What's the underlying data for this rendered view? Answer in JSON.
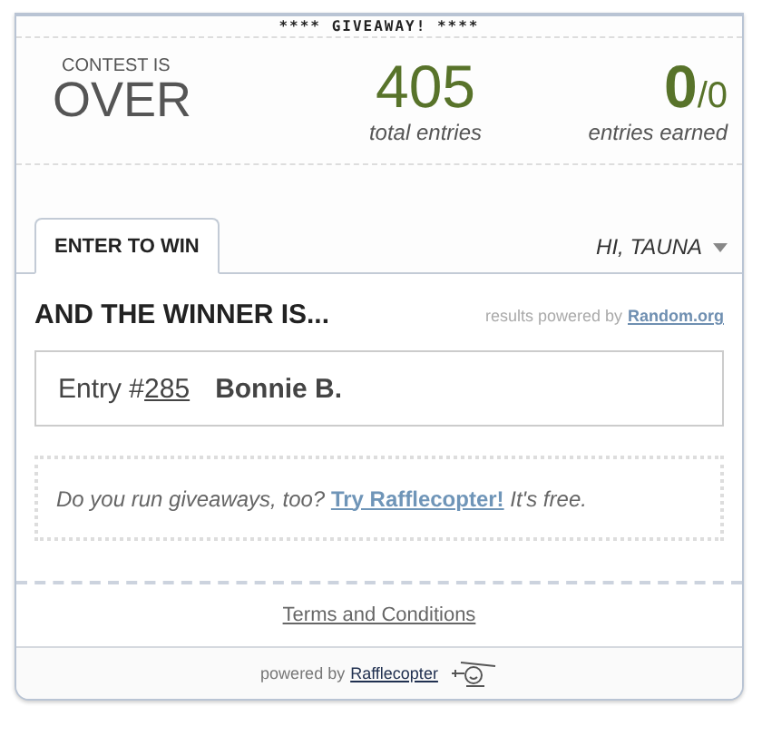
{
  "banner": "**** GIVEAWAY! ****",
  "status": {
    "caption": "CONTEST IS",
    "value": "OVER"
  },
  "stats": [
    {
      "value": "405",
      "label": "total entries"
    },
    {
      "value": "0",
      "suffix": "/0",
      "label": "entries earned"
    }
  ],
  "tabs": [
    {
      "label": "ENTER TO WIN",
      "selected": true
    }
  ],
  "user_menu": {
    "label": "HI, TAUNA"
  },
  "winner": {
    "heading": "AND THE WINNER IS...",
    "credit": "results powered by",
    "credit_link": "Random.org",
    "entry_prefix": "Entry #",
    "entry_number": "285",
    "name": "Bonnie B."
  },
  "promo": {
    "before": "Do you run giveaways, too?",
    "link": "Try Rafflecopter!",
    "after": "It's free."
  },
  "terms_link": "Terms and Conditions",
  "footer": {
    "text": "powered by",
    "link": "Rafflecopter"
  }
}
